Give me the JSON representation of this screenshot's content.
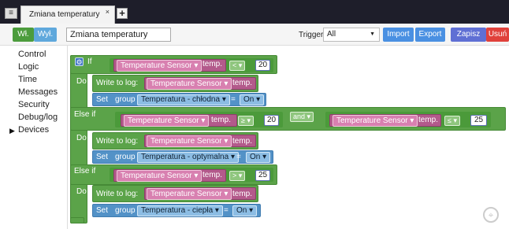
{
  "window": {
    "tab_title": "Zmiana temperatury",
    "tab_close": "×",
    "tab_add": "+",
    "menu_icon": "≡"
  },
  "toolbar": {
    "on_label": "Wł.",
    "off_label": "Wył.",
    "script_name": "Zmiana temperatury",
    "trigger_label": "Trigger",
    "trigger_value": "All",
    "import_label": "Import",
    "export_label": "Export",
    "save_label": "Zapisz",
    "delete_label": "Usuń"
  },
  "sidebar": {
    "items": [
      {
        "label": "Control"
      },
      {
        "label": "Logic"
      },
      {
        "label": "Time"
      },
      {
        "label": "Messages"
      },
      {
        "label": "Security"
      },
      {
        "label": "Debug/log"
      },
      {
        "label": "Devices",
        "expandable": true
      }
    ]
  },
  "blocks": {
    "if_label": "If",
    "do_label": "Do",
    "else_if_label": "Else if",
    "write_log_label": "Write to log:",
    "set_label": "Set",
    "group_label": "group",
    "and_label": "and",
    "eq_label": "=",
    "sensor": "Temperature Sensor",
    "temp_label": "temp.",
    "on_value": "On",
    "cond1": {
      "op": "<",
      "value": "20"
    },
    "cond2": {
      "op1": "≥",
      "value1": "20",
      "op2": "≤",
      "value2": "25"
    },
    "cond3": {
      "op": ">",
      "value": "25"
    },
    "group1": "Temperatura - chłodna",
    "group2": "Temperatura - optymalna",
    "group3": "Temperatura - ciepła"
  },
  "colors": {
    "logic_green": "#5ba349",
    "device_pink": "#b35a8b",
    "set_blue": "#5392c7",
    "save_button": "#5f6fd4",
    "delete_button": "#e0413b"
  }
}
